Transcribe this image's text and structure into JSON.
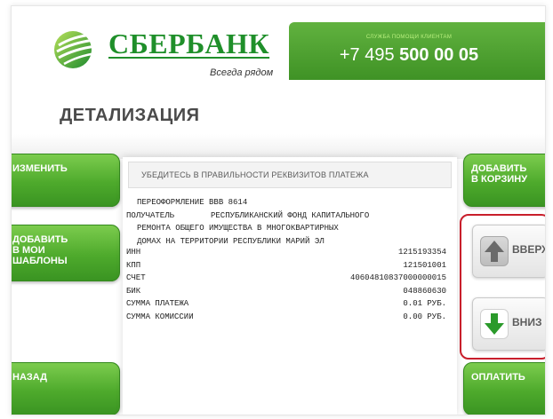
{
  "header": {
    "brand_name": "СБЕРБАНК",
    "brand_slogan": "Всегда рядом",
    "helpline_label": "СЛУЖБА ПОМОЩИ КЛИЕНТАМ",
    "helpline_phone_prefix": "+7 495 ",
    "helpline_phone_number": "500 00 05"
  },
  "page": {
    "title": "ДЕТАЛИЗАЦИЯ"
  },
  "left_buttons": {
    "change": "ИЗМЕНИТЬ",
    "add_templates": "ДОБАВИТЬ\nВ МОИ\nШАБЛОНЫ",
    "back": "НАЗАД"
  },
  "right_buttons": {
    "add_to_cart": "ДОБАВИТЬ\nВ КОРЗИНУ",
    "pay": "ОПЛАТИТЬ"
  },
  "scroll": {
    "up_label": "ВВЕРХ",
    "down_label": "ВНИЗ"
  },
  "receipt": {
    "header": "УБЕДИТЕСЬ В ПРАВИЛЬНОСТИ РЕКВИЗИТОВ ПЛАТЕЖА",
    "purpose": "ПЕРЕОФОРМЛЕНИЕ ВВВ 8614",
    "recipient_label": "ПОЛУЧАТЕЛЬ",
    "recipient_line1": "РЕСПУБЛИКАНСКИЙ ФОНД КАПИТАЛЬНОГО",
    "recipient_line2": "РЕМОНТА ОБЩЕГО ИМУЩЕСТВА В МНОГОКВАРТИРНЫХ",
    "recipient_line3": "ДОМАХ НА ТЕРРИТОРИИ РЕСПУБЛИКИ МАРИЙ ЭЛ",
    "fields": [
      {
        "label": "ИНН",
        "value": "1215193354"
      },
      {
        "label": "КПП",
        "value": "121501001"
      },
      {
        "label": "СЧЕТ",
        "value": "40604810837000000015"
      },
      {
        "label": "БИК",
        "value": "048860630"
      },
      {
        "label": "СУММА ПЛАТЕЖА",
        "value": "0.01 РУБ."
      },
      {
        "label": "СУММА КОМИССИИ",
        "value": "0.00 РУБ."
      }
    ]
  },
  "colors": {
    "brand_green": "#1f8f2a",
    "button_green": "#4eaa2c",
    "highlight_red": "#c81e2b"
  }
}
